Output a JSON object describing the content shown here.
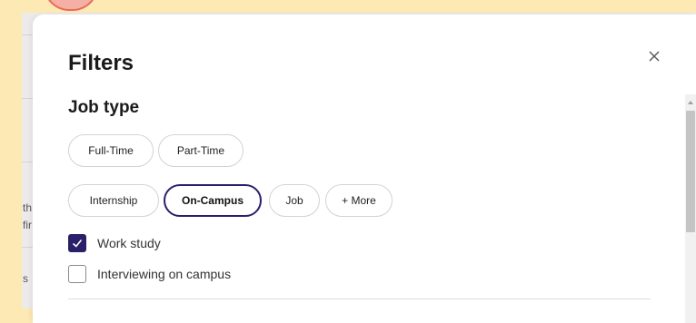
{
  "background": {
    "snippets": [
      "th",
      "fir",
      "s"
    ]
  },
  "modal": {
    "title": "Filters",
    "close_symbol": "×"
  },
  "job_type": {
    "title": "Job type",
    "options": [
      {
        "label": "Full-Time",
        "selected": false
      },
      {
        "label": "Part-Time",
        "selected": false
      },
      {
        "label": "Internship",
        "selected": false
      },
      {
        "label": "On-Campus",
        "selected": true
      },
      {
        "label": "Job",
        "selected": false
      },
      {
        "label": "+ More",
        "selected": false
      }
    ],
    "sub_options": [
      {
        "label": "Work study",
        "checked": true
      },
      {
        "label": "Interviewing on campus",
        "checked": false
      }
    ]
  },
  "icons": {
    "close": "close-icon",
    "check": "checkmark-icon",
    "scroll_up": "caret-up-icon"
  },
  "colors": {
    "selected_accent": "#2a1f69",
    "page_background": "#fde9b3"
  }
}
